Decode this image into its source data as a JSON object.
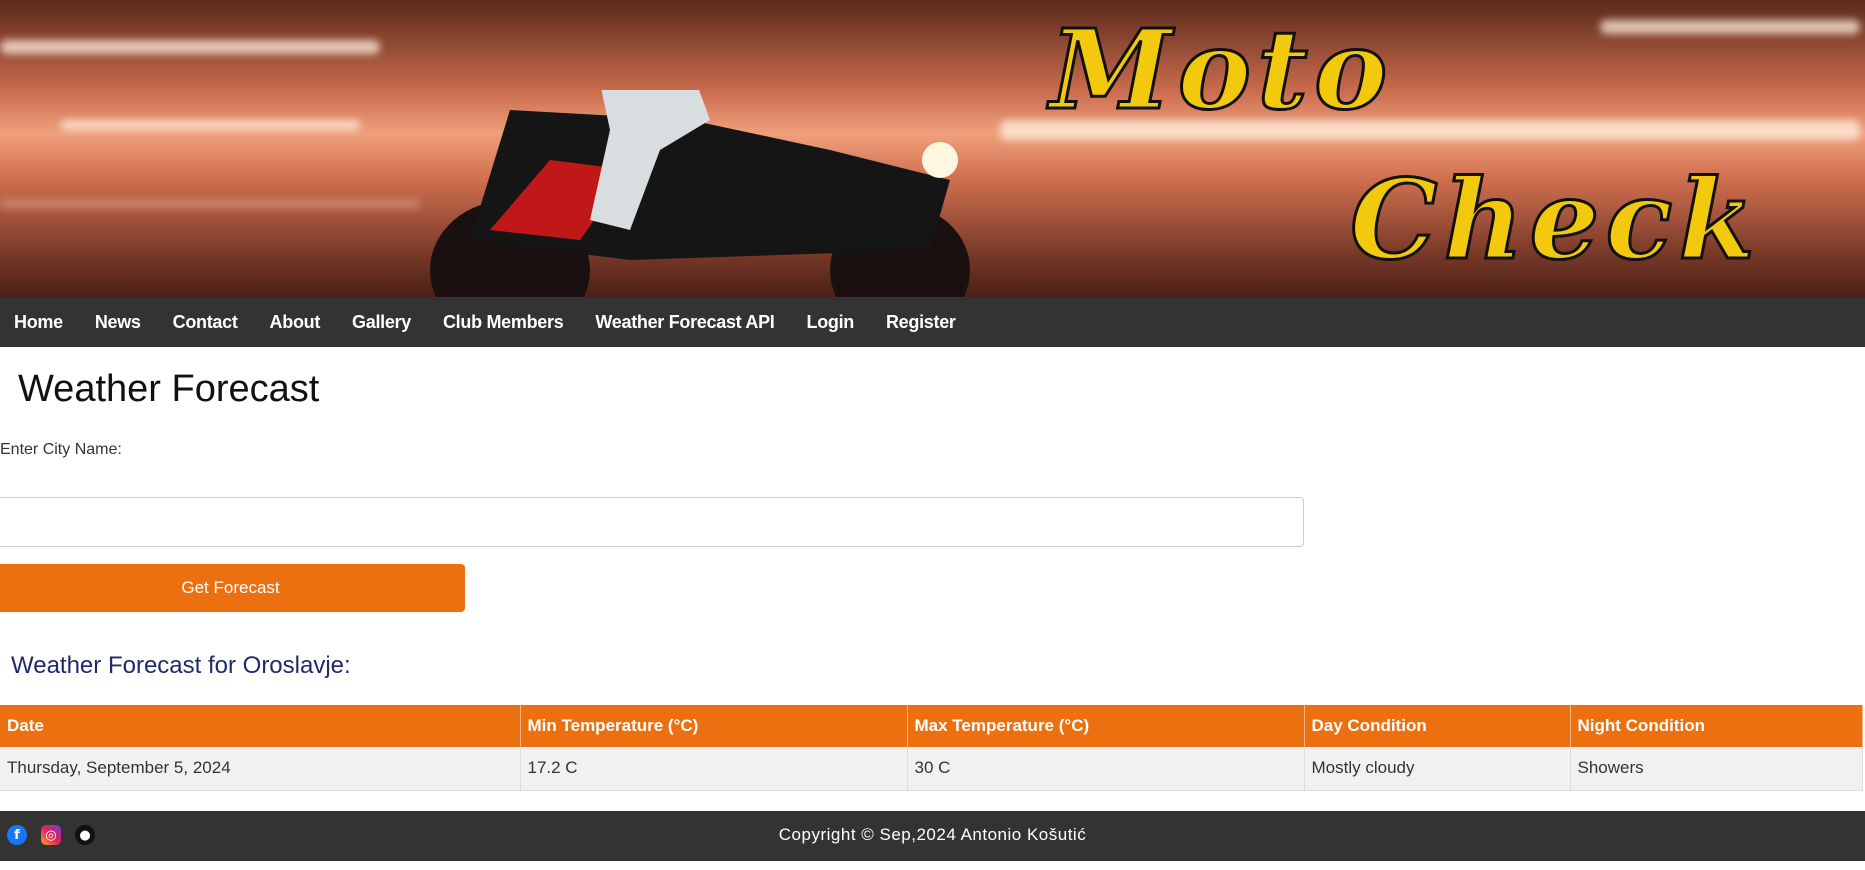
{
  "banner": {
    "logo_line1": "Moto",
    "logo_line2": "Check"
  },
  "nav": {
    "items": [
      "Home",
      "News",
      "Contact",
      "About",
      "Gallery",
      "Club Members",
      "Weather Forecast API",
      "Login",
      "Register"
    ]
  },
  "main": {
    "title": "Weather Forecast",
    "city_label": "Enter City Name:",
    "city_value": "",
    "button": "Get Forecast",
    "result_heading": "Weather Forecast for Oroslavje:"
  },
  "table": {
    "headers": [
      "Date",
      "Min Temperature (°C)",
      "Max Temperature (°C)",
      "Day Condition",
      "Night Condition"
    ],
    "rows": [
      [
        "Thursday, September 5, 2024",
        "17.2 C",
        "30 C",
        "Mostly cloudy",
        "Showers"
      ]
    ]
  },
  "footer": {
    "copyright": "Copyright © Sep,2024 Antonio Košutić",
    "icons": [
      "facebook-icon",
      "instagram-icon",
      "github-icon"
    ]
  },
  "colors": {
    "accent": "#ec700f",
    "nav": "#333333",
    "heading": "#1f2a6b",
    "logo": "#f2c90c"
  }
}
